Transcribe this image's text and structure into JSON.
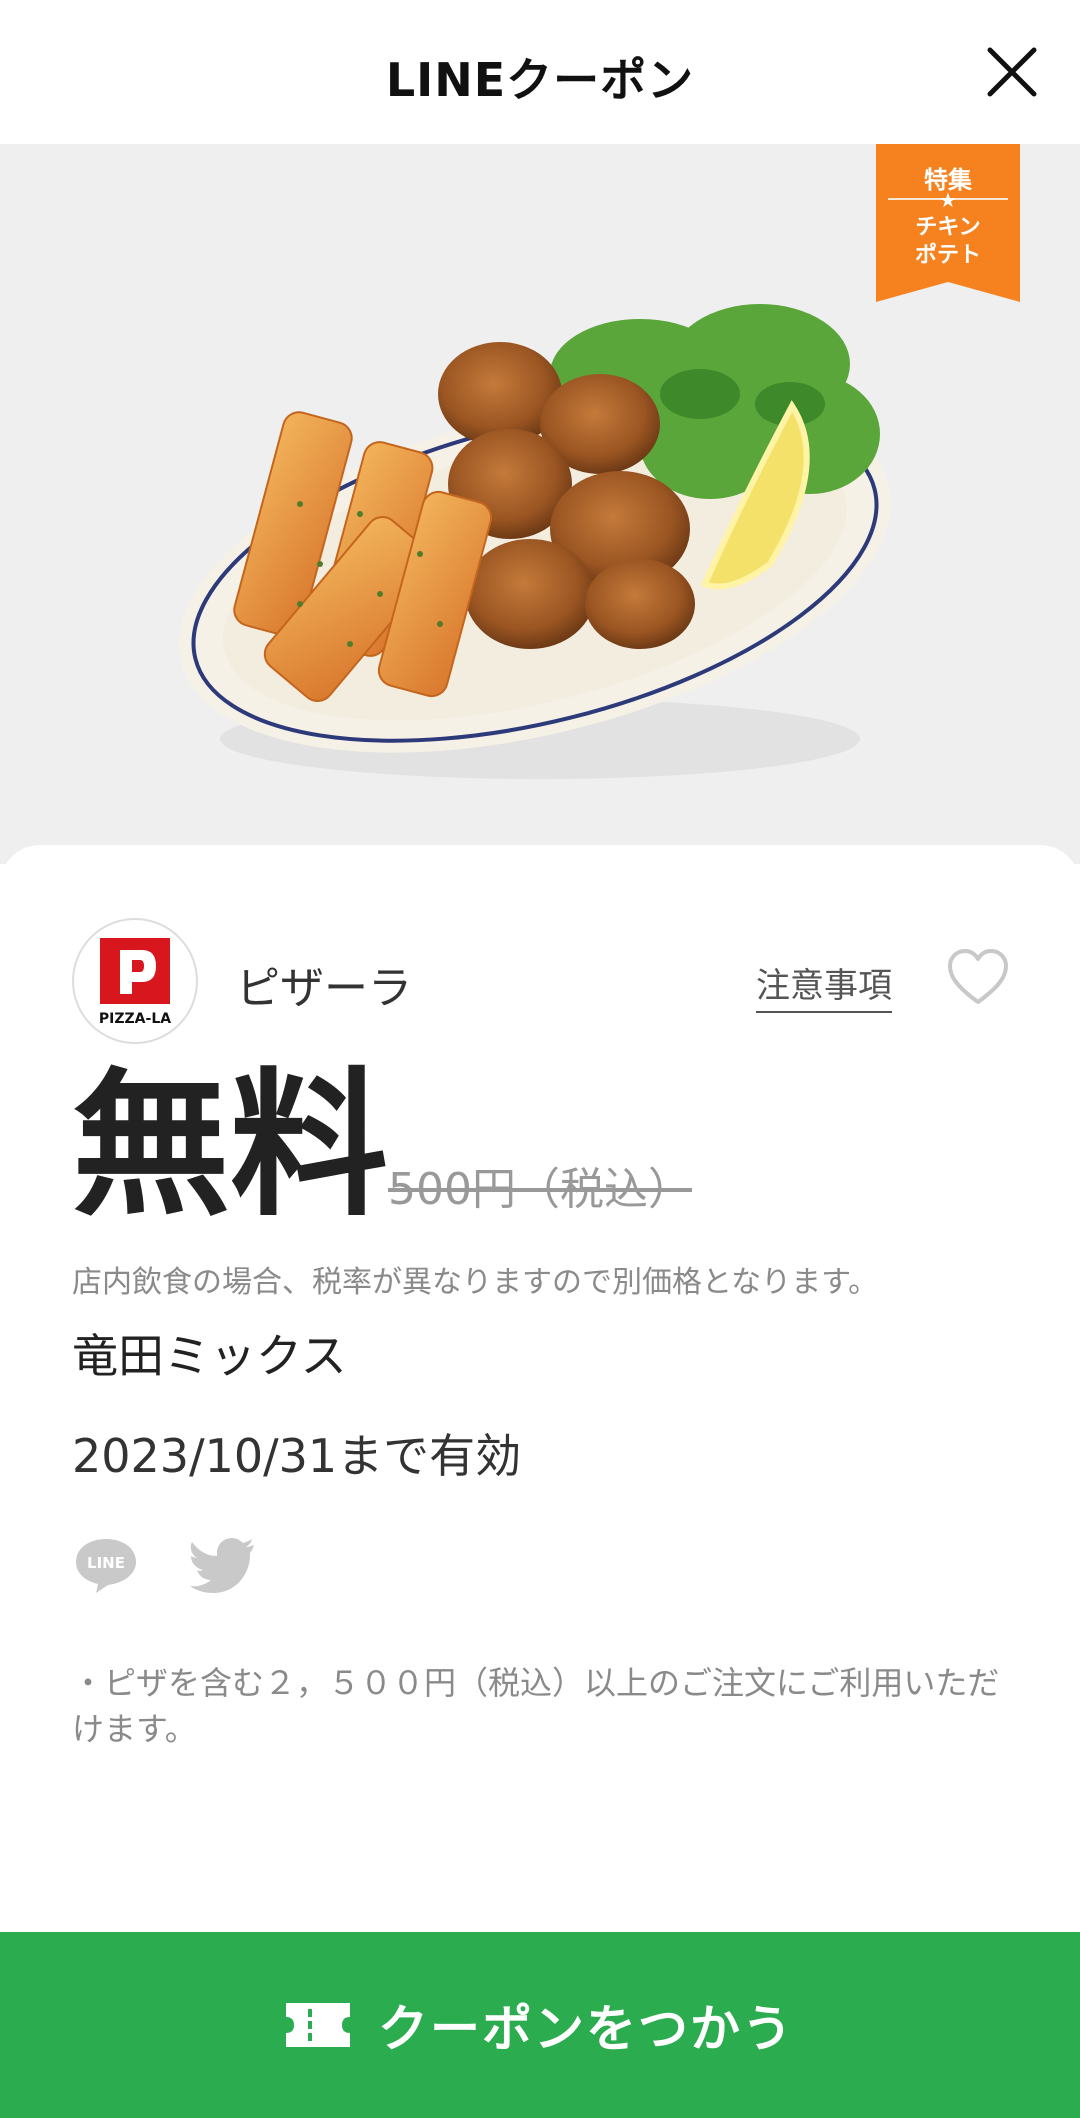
{
  "header": {
    "title": "LINEクーポン",
    "close_icon": "close-icon"
  },
  "hero": {
    "badge": {
      "top": "特集",
      "star": "★",
      "bottom_line1": "チキン",
      "bottom_line2": "ポテト",
      "color": "#f5821f"
    }
  },
  "store": {
    "name": "ピザーラ",
    "logo_text": "PIZZA-LA",
    "notes_label": "注意事項",
    "favorite_icon": "heart-icon"
  },
  "coupon": {
    "price": "無料",
    "original_price": "500円（税込）",
    "tax_note": "店内飲食の場合、税率が異なりますので別価格となります。",
    "product": "竜田ミックス",
    "valid_until": "2023/10/31まで有効"
  },
  "share": {
    "line_label": "LINE",
    "twitter_icon": "twitter-icon"
  },
  "conditions": [
    "・ピザを含む２，５００円（税込）以上のご注文にご利用いただけます。"
  ],
  "action": {
    "use_label": "クーポンをつかう",
    "color": "#2aac4f"
  }
}
